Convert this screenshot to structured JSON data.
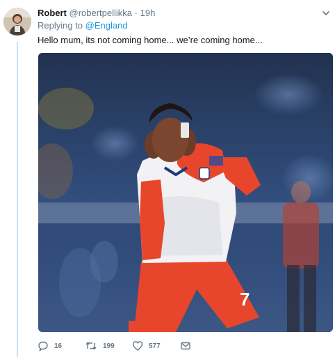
{
  "tweet": {
    "author_name": "Robert",
    "author_handle": "@robertpellikka",
    "separator": "·",
    "time": "19h",
    "replying_prefix": "Replying to",
    "replying_to": "@England",
    "text": "Hello mum, its not coming home... we’re coming home..."
  },
  "media": {
    "shirt_number": "7"
  },
  "actions": {
    "reply_count": "16",
    "retweet_count": "199",
    "like_count": "577"
  },
  "colors": {
    "link": "#1b95e0",
    "secondary_text": "#657786",
    "thread_line": "#c4e1f5",
    "kit_red": "#e8462c"
  },
  "icons": {
    "reply": "reply-icon",
    "retweet": "retweet-icon",
    "like": "heart-icon",
    "dm": "envelope-icon",
    "menu": "chevron-down-icon"
  }
}
